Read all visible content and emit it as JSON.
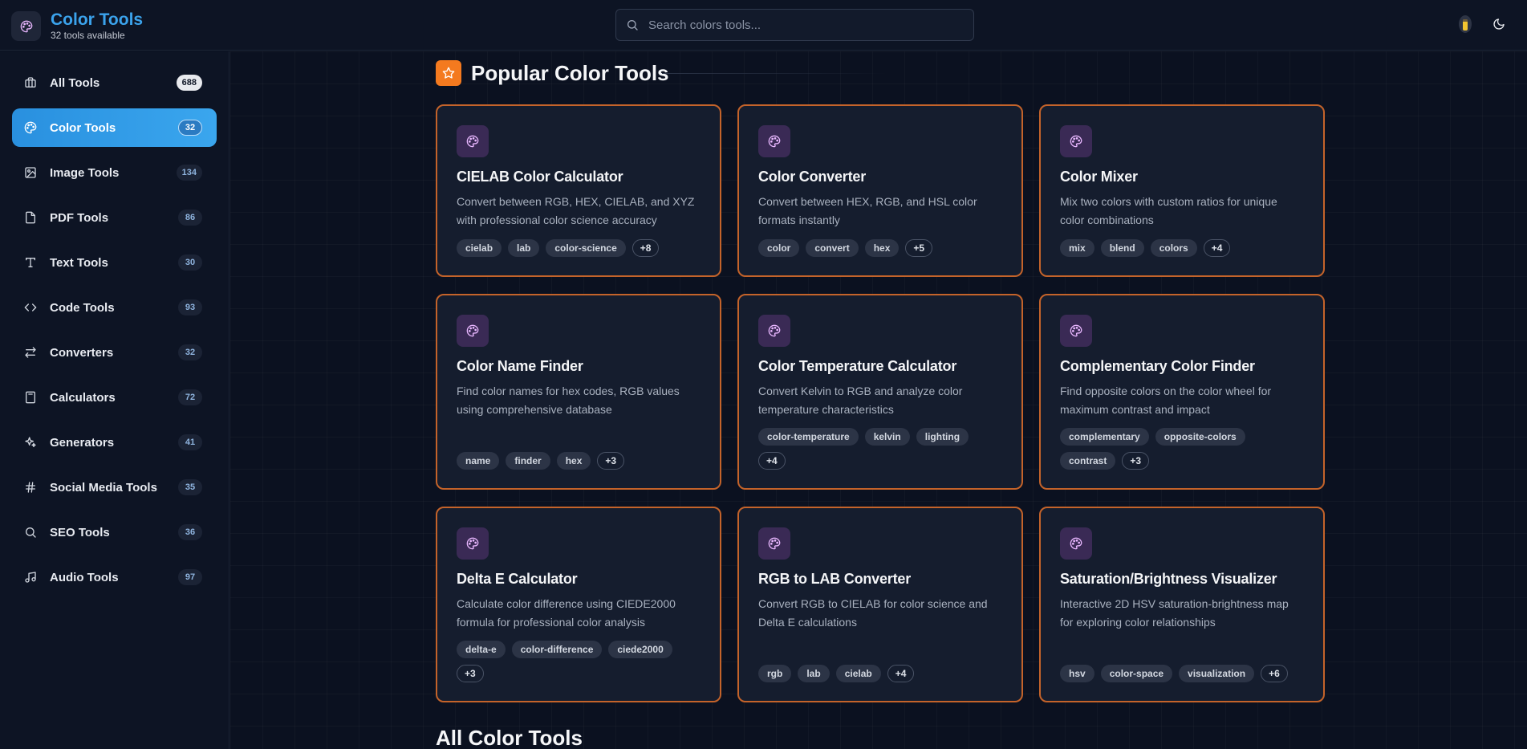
{
  "brand": {
    "title": "Color Tools",
    "subtitle": "32 tools available"
  },
  "search": {
    "placeholder": "Search colors tools..."
  },
  "sidebar": {
    "items": [
      {
        "label": "All Tools",
        "count": "688"
      },
      {
        "label": "Color Tools",
        "count": "32"
      },
      {
        "label": "Image Tools",
        "count": "134"
      },
      {
        "label": "PDF Tools",
        "count": "86"
      },
      {
        "label": "Text Tools",
        "count": "30"
      },
      {
        "label": "Code Tools",
        "count": "93"
      },
      {
        "label": "Converters",
        "count": "32"
      },
      {
        "label": "Calculators",
        "count": "72"
      },
      {
        "label": "Generators",
        "count": "41"
      },
      {
        "label": "Social Media Tools",
        "count": "35"
      },
      {
        "label": "SEO Tools",
        "count": "36"
      },
      {
        "label": "Audio Tools",
        "count": "97"
      }
    ]
  },
  "main": {
    "section_title": "Popular Color Tools",
    "all_title": "All Color Tools",
    "cards": [
      {
        "title": "CIELAB Color Calculator",
        "desc": "Convert between RGB, HEX, CIELAB, and XYZ with professional color science accuracy",
        "tags": [
          "cielab",
          "lab",
          "color-science"
        ],
        "more": "+8"
      },
      {
        "title": "Color Converter",
        "desc": "Convert between HEX, RGB, and HSL color formats instantly",
        "tags": [
          "color",
          "convert",
          "hex"
        ],
        "more": "+5"
      },
      {
        "title": "Color Mixer",
        "desc": "Mix two colors with custom ratios for unique color combinations",
        "tags": [
          "mix",
          "blend",
          "colors"
        ],
        "more": "+4"
      },
      {
        "title": "Color Name Finder",
        "desc": "Find color names for hex codes, RGB values using comprehensive database",
        "tags": [
          "name",
          "finder",
          "hex"
        ],
        "more": "+3"
      },
      {
        "title": "Color Temperature Calculator",
        "desc": "Convert Kelvin to RGB and analyze color temperature characteristics",
        "tags": [
          "color-temperature",
          "kelvin",
          "lighting"
        ],
        "more": "+4"
      },
      {
        "title": "Complementary Color Finder",
        "desc": "Find opposite colors on the color wheel for maximum contrast and impact",
        "tags": [
          "complementary",
          "opposite-colors",
          "contrast"
        ],
        "more": "+3"
      },
      {
        "title": "Delta E Calculator",
        "desc": "Calculate color difference using CIEDE2000 formula for professional color analysis",
        "tags": [
          "delta-e",
          "color-difference",
          "ciede2000"
        ],
        "more": "+3"
      },
      {
        "title": "RGB to LAB Converter",
        "desc": "Convert RGB to CIELAB for color science and Delta E calculations",
        "tags": [
          "rgb",
          "lab",
          "cielab"
        ],
        "more": "+4"
      },
      {
        "title": "Saturation/Brightness Visualizer",
        "desc": "Interactive 2D HSV saturation-brightness map for exploring color relationships",
        "tags": [
          "hsv",
          "color-space",
          "visualization"
        ],
        "more": "+6"
      }
    ]
  },
  "colors": {
    "accent": "#3ba3ec",
    "card_border": "#c4632a",
    "popular_badge": "#f47a1f",
    "active_nav": "#2990df"
  }
}
